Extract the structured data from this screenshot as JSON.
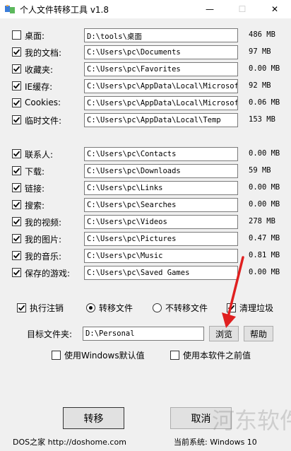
{
  "window": {
    "title": "个人文件转移工具 v1.8",
    "min": "—",
    "max": "☐",
    "close": "✕"
  },
  "colors": {
    "accent": "#0078d7",
    "arrow": "#e02020",
    "text": "#000000"
  },
  "group1": [
    {
      "label": "桌面:",
      "checked": false,
      "path": "D:\\tools\\桌面",
      "size": "486 MB"
    },
    {
      "label": "我的文档:",
      "checked": true,
      "path": "C:\\Users\\pc\\Documents",
      "size": "97 MB"
    },
    {
      "label": "收藏夹:",
      "checked": true,
      "path": "C:\\Users\\pc\\Favorites",
      "size": "0.00 MB"
    },
    {
      "label": "IE缓存:",
      "checked": true,
      "path": "C:\\Users\\pc\\AppData\\Local\\Microsoft\\",
      "size": "92 MB"
    },
    {
      "label": "Cookies:",
      "checked": true,
      "path": "C:\\Users\\pc\\AppData\\Local\\Microsoft\\",
      "size": "0.06 MB"
    },
    {
      "label": "临时文件:",
      "checked": true,
      "path": "C:\\Users\\pc\\AppData\\Local\\Temp",
      "size": "153 MB"
    }
  ],
  "group2": [
    {
      "label": "联系人:",
      "checked": true,
      "path": "C:\\Users\\pc\\Contacts",
      "size": "0.00 MB"
    },
    {
      "label": "下载:",
      "checked": true,
      "path": "C:\\Users\\pc\\Downloads",
      "size": "59 MB"
    },
    {
      "label": "链接:",
      "checked": true,
      "path": "C:\\Users\\pc\\Links",
      "size": "0.00 MB"
    },
    {
      "label": "搜索:",
      "checked": true,
      "path": "C:\\Users\\pc\\Searches",
      "size": "0.00 MB"
    },
    {
      "label": "我的视频:",
      "checked": true,
      "path": "C:\\Users\\pc\\Videos",
      "size": "278 MB"
    },
    {
      "label": "我的图片:",
      "checked": true,
      "path": "C:\\Users\\pc\\Pictures",
      "size": "0.47 MB"
    },
    {
      "label": "我的音乐:",
      "checked": true,
      "path": "C:\\Users\\pc\\Music",
      "size": "0.81 MB"
    },
    {
      "label": "保存的游戏:",
      "checked": true,
      "path": "C:\\Users\\pc\\Saved Games",
      "size": "0.00 MB"
    }
  ],
  "options": {
    "logoff": {
      "label": "执行注销",
      "checked": true
    },
    "mode_move": {
      "label": "转移文件",
      "selected": true
    },
    "mode_nomove": {
      "label": "不转移文件",
      "selected": false
    },
    "cleanup": {
      "label": "清理垃圾",
      "checked": true
    }
  },
  "target": {
    "label": "目标文件夹:",
    "value": "D:\\Personal",
    "browse": "浏览",
    "help": "帮助"
  },
  "defaults": {
    "windows_default": {
      "label": "使用Windows默认值",
      "checked": false
    },
    "previous": {
      "label": "使用本软件之前值",
      "checked": false
    }
  },
  "actions": {
    "transfer": "转移",
    "cancel": "取消"
  },
  "footer": {
    "credit": "DOS之家 http://doshome.com",
    "system": "当前系统: Windows 10"
  },
  "watermark": "河东软件园"
}
